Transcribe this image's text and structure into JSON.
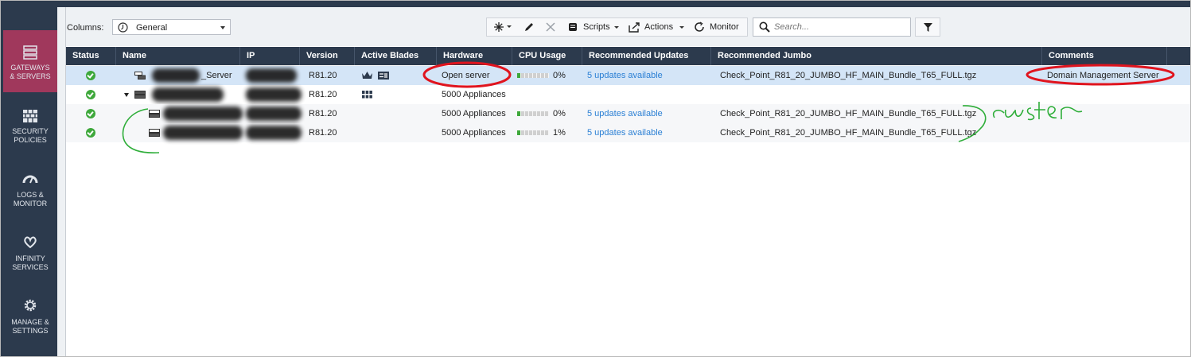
{
  "sidebar": {
    "items": [
      {
        "label_l1": "GATEWAYS",
        "label_l2": "& SERVERS",
        "icon": "gateways-icon"
      },
      {
        "label_l1": "SECURITY",
        "label_l2": "POLICIES",
        "icon": "firewall-icon"
      },
      {
        "label_l1": "LOGS &",
        "label_l2": "MONITOR",
        "icon": "gauge-icon"
      },
      {
        "label_l1": "INFINITY",
        "label_l2": "SERVICES",
        "icon": "infinity-icon"
      },
      {
        "label_l1": "MANAGE &",
        "label_l2": "SETTINGS",
        "icon": "gear-icon"
      }
    ]
  },
  "toolbar": {
    "columns_label": "Columns:",
    "columns_value": "General",
    "scripts_label": "Scripts",
    "actions_label": "Actions",
    "monitor_label": "Monitor",
    "search_placeholder": "Search..."
  },
  "table": {
    "columns": [
      "Status",
      "Name",
      "IP",
      "Version",
      "Active Blades",
      "Hardware",
      "CPU Usage",
      "Recommended Updates",
      "Recommended Jumbo",
      "Comments"
    ],
    "rows": [
      {
        "status": "ok",
        "name": "_Server",
        "ip": "",
        "version": "R81.20",
        "hardware": "Open server",
        "cpu": "0%",
        "cpu_fraction": 0.0,
        "updates": "5 updates available",
        "jumbo": "Check_Point_R81_20_JUMBO_HF_MAIN_Bundle_T65_FULL.tgz",
        "comments": "Domain Management Server"
      },
      {
        "status": "ok",
        "name": "",
        "ip": "",
        "version": "R81.20",
        "hardware": "5000 Appliances",
        "cpu": "",
        "updates": "",
        "jumbo": "",
        "comments": ""
      },
      {
        "status": "ok",
        "name": "",
        "ip": "",
        "version": "R81.20",
        "hardware": "5000 Appliances",
        "cpu": "0%",
        "cpu_fraction": 0.0,
        "updates": "5 updates available",
        "jumbo": "Check_Point_R81_20_JUMBO_HF_MAIN_Bundle_T65_FULL.tgz",
        "comments": ""
      },
      {
        "status": "ok",
        "name": "",
        "ip": "",
        "version": "R81.20",
        "hardware": "5000 Appliances",
        "cpu": "1%",
        "cpu_fraction": 0.01,
        "updates": "5 updates available",
        "jumbo": "Check_Point_R81_20_JUMBO_HF_MAIN_Bundle_T65_FULL.tgz",
        "comments": ""
      }
    ]
  },
  "colors": {
    "sidebar_bg": "#2c3a4d",
    "sidebar_active": "#a0385c",
    "header_bg": "#2c3a4d",
    "selected_row": "#d4e5f7",
    "status_ok": "#3ea83b",
    "link": "#2a7fd4",
    "annotation_red": "#e0141e",
    "annotation_green": "#2fae3a"
  }
}
